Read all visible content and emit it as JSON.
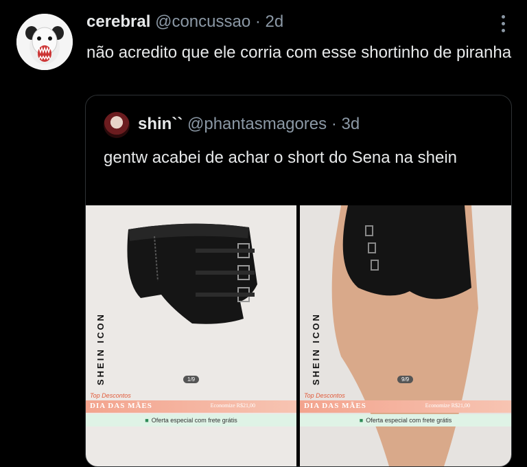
{
  "tweet": {
    "display_name": "cerebral",
    "handle": "@concussao",
    "separator": " · ",
    "time": "2d",
    "text": "não acredito que ele corria com esse shortinho de piranha"
  },
  "quote": {
    "display_name": "shin``",
    "handle": "@phantasmagores",
    "separator": " · ",
    "time": "3d",
    "text": "gentw acabei de achar o short do Sena na shein"
  },
  "media": {
    "brand": "SHEIN ICON",
    "left": {
      "page": "1/9",
      "promo_label": "Top Descontos",
      "promo_title": "DIA DAS MÃES",
      "promo_savings": "Economize R$21,00",
      "offer": "Oferta especial com frete grátis"
    },
    "right": {
      "page": "9/9",
      "promo_label": "Top Descontos",
      "promo_title": "DIA DAS MÃES",
      "promo_savings": "Economize R$21,00",
      "offer": "Oferta especial com frete grátis"
    }
  },
  "colors": {
    "background": "#000000",
    "text": "#e7e9ea",
    "muted": "#8b98a5",
    "border": "#2f3336",
    "promo": "#f3a48e",
    "offer_bg": "#dff3e6"
  }
}
